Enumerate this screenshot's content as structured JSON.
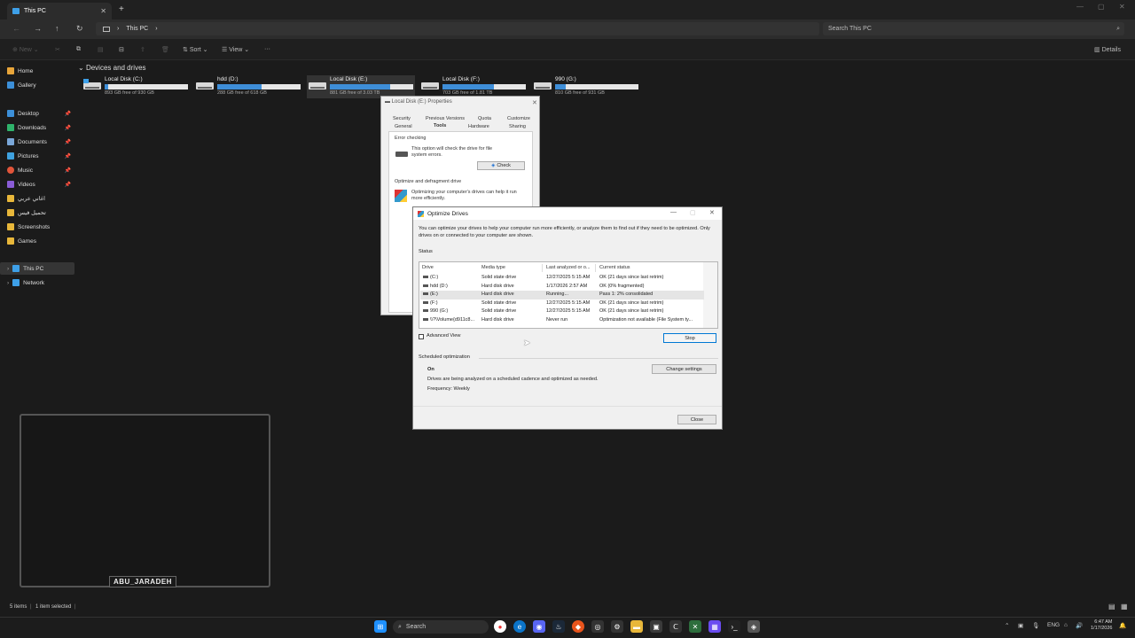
{
  "explorer": {
    "tab_title": "This PC",
    "address_location": "This PC",
    "search_placeholder": "Search This PC",
    "toolbar": {
      "new": "New",
      "sort": "Sort",
      "view": "View",
      "more": "···",
      "details": "Details"
    }
  },
  "sidebar": {
    "items": [
      {
        "label": "Home",
        "pinned": false
      },
      {
        "label": "Gallery",
        "pinned": false
      },
      {
        "label": "Desktop",
        "pinned": true
      },
      {
        "label": "Downloads",
        "pinned": true
      },
      {
        "label": "Documents",
        "pinned": true
      },
      {
        "label": "Pictures",
        "pinned": true
      },
      {
        "label": "Music",
        "pinned": true
      },
      {
        "label": "Videos",
        "pinned": true
      },
      {
        "label": "اغاني عربي",
        "pinned": false
      },
      {
        "label": "تحميل فيس",
        "pinned": false
      },
      {
        "label": "Screenshots",
        "pinned": false
      },
      {
        "label": "Games",
        "pinned": false
      },
      {
        "label": "This PC",
        "pinned": false
      },
      {
        "label": "Network",
        "pinned": false
      }
    ]
  },
  "devices_header": "Devices and drives",
  "drives": [
    {
      "name": "Local Disk (C:)",
      "free": "893 GB free of 930 GB",
      "used_fraction": 0.04
    },
    {
      "name": "hdd (D:)",
      "free": "288 GB free of 618 GB",
      "used_fraction": 0.53
    },
    {
      "name": "Local Disk (E:)",
      "free": "881 GB free of 3.03 TB",
      "used_fraction": 0.72
    },
    {
      "name": "Local Disk (F:)",
      "free": "703 GB free of 1.81 TB",
      "used_fraction": 0.62
    },
    {
      "name": "990 (G:)",
      "free": "810 GB free of 931 GB",
      "used_fraction": 0.13
    }
  ],
  "properties_dialog": {
    "title": "Local Disk (E:) Properties",
    "tabs_row1": [
      "Security",
      "Previous Versions",
      "Quota",
      "Customize"
    ],
    "tabs_row2": [
      "General",
      "Tools",
      "Hardware",
      "Sharing"
    ],
    "error_checking_title": "Error checking",
    "error_checking_text": "This option will check the drive for file system errors.",
    "check_button": "Check",
    "optimize_title": "Optimize and defragment drive",
    "optimize_text": "Optimizing your computer's drives can help it run more efficiently."
  },
  "optimize_dialog": {
    "title": "Optimize Drives",
    "description": "You can optimize your drives to help your computer run more efficiently, or analyze them to find out if they need to be optimized. Only drives on or connected to your computer are shown.",
    "status_label": "Status",
    "columns": [
      "Drive",
      "Media type",
      "Last analyzed or o...",
      "Current status"
    ],
    "rows": [
      {
        "drive": "(C:)",
        "media": "Solid state drive",
        "last": "12/27/2025 5:15 AM",
        "status": "OK (21 days since last retrim)"
      },
      {
        "drive": "hdd (D:)",
        "media": "Hard disk drive",
        "last": "1/17/2026 2:57 AM",
        "status": "OK (0% fragmented)"
      },
      {
        "drive": "(E:)",
        "media": "Hard disk drive",
        "last": "Running...",
        "status": "Pass 1: 2% consolidated"
      },
      {
        "drive": "(F:)",
        "media": "Solid state drive",
        "last": "12/27/2025 5:15 AM",
        "status": "OK (21 days since last retrim)"
      },
      {
        "drive": "990 (G:)",
        "media": "Solid state drive",
        "last": "12/27/2025 5:15 AM",
        "status": "OK (21 days since last retrim)"
      },
      {
        "drive": "\\\\?\\Volume{d911c8...",
        "media": "Hard disk drive",
        "last": "Never run",
        "status": "Optimization not available (File System ty..."
      }
    ],
    "advanced_view": "Advanced View",
    "stop_button": "Stop",
    "scheduled_label": "Scheduled optimization",
    "schedule_state": "On",
    "schedule_text": "Drives are being analyzed on a scheduled cadence and optimized as needed.",
    "frequency": "Frequency: Weekly",
    "change_settings_button": "Change settings",
    "close_button": "Close"
  },
  "statusbar": {
    "items": "5 items",
    "selected": "1 item selected"
  },
  "overlay_name": "ABU_JARADEH",
  "taskbar": {
    "search": "Search",
    "lang": "ENG",
    "time": "6:47 AM",
    "date": "1/17/2026"
  }
}
